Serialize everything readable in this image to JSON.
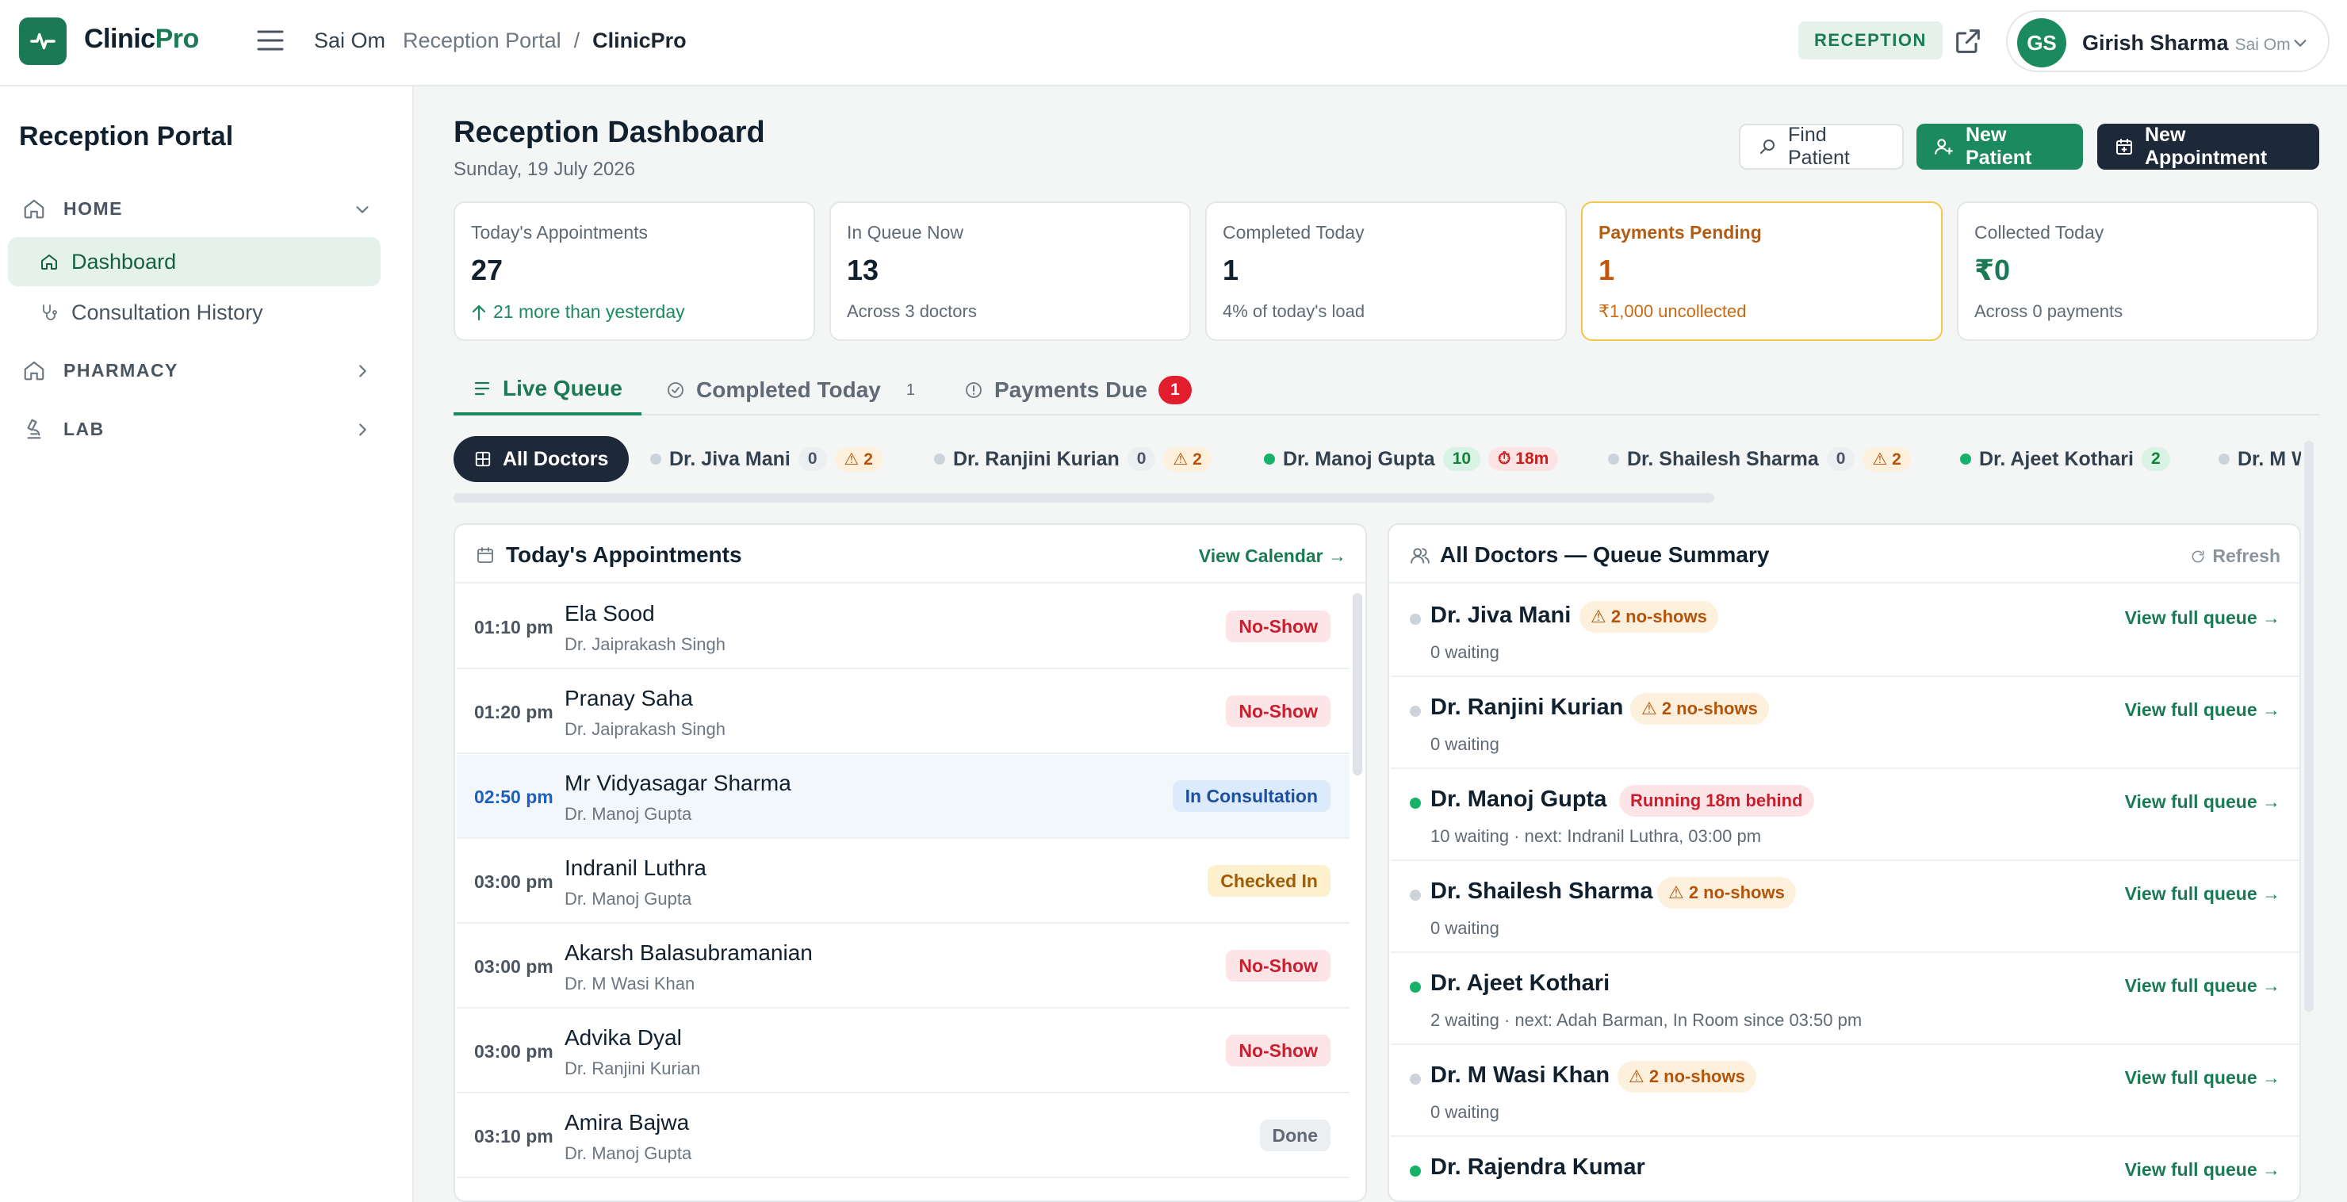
{
  "app": {
    "brand_main": "Clinic",
    "brand_accent": "Pro",
    "clinic": "Sai Om",
    "breadcrumb": [
      "Reception Portal",
      "/",
      "ClinicPro"
    ],
    "role": "RECEPTION"
  },
  "user": {
    "initials": "GS",
    "name": "Girish Sharma",
    "sub": "Sai Om"
  },
  "sidebar": {
    "title": "Reception Portal",
    "home": "HOME",
    "items": [
      "Dashboard",
      "Consultation History"
    ],
    "pharmacy": "PHARMACY",
    "lab": "LAB"
  },
  "page": {
    "title": "Reception Dashboard",
    "date": "Sunday, 19 July 2026"
  },
  "actions": {
    "find": "Find Patient",
    "new_patient": "New Patient",
    "new_appt": "New Appointment"
  },
  "stats": [
    {
      "label": "Today's Appointments",
      "value": "27",
      "sub": "21 more than yesterday"
    },
    {
      "label": "In Queue Now",
      "value": "13",
      "sub": "Across 3 doctors"
    },
    {
      "label": "Completed Today",
      "value": "1",
      "sub": "4% of today's load"
    },
    {
      "label": "Payments Pending",
      "value": "1",
      "sub": "₹1,000 uncollected"
    },
    {
      "label": "Collected Today",
      "value": "₹0",
      "sub": "Across 0 payments"
    }
  ],
  "tabs": [
    {
      "label": "Live Queue"
    },
    {
      "label": "Completed Today",
      "count": "1"
    },
    {
      "label": "Payments Due",
      "count": "1"
    }
  ],
  "doctor_chips": {
    "all": "All Doctors",
    "items": [
      {
        "name": "Dr. Jiva Mani",
        "count": "0",
        "warn": "⚠ 2"
      },
      {
        "name": "Dr. Ranjini Kurian",
        "count": "0",
        "warn": "⚠ 2"
      },
      {
        "name": "Dr. Manoj Gupta",
        "count": "10",
        "late": "⏱ 18m"
      },
      {
        "name": "Dr. Shailesh Sharma",
        "count": "0",
        "warn": "⚠ 2"
      },
      {
        "name": "Dr. Ajeet Kothari",
        "count": "2"
      },
      {
        "name": "Dr. M W"
      }
    ]
  },
  "appointments": {
    "title": "Today's Appointments",
    "link": "View Calendar →",
    "rows": [
      {
        "time": "01:10 pm",
        "patient": "Ela Sood",
        "doctor": "Dr. Jaiprakash Singh",
        "status": "No-Show"
      },
      {
        "time": "01:20 pm",
        "patient": "Pranay Saha",
        "doctor": "Dr. Jaiprakash Singh",
        "status": "No-Show"
      },
      {
        "time": "02:50 pm",
        "patient": "Mr Vidyasagar Sharma",
        "doctor": "Dr. Manoj Gupta",
        "status": "In Consultation"
      },
      {
        "time": "03:00 pm",
        "patient": "Indranil Luthra",
        "doctor": "Dr. Manoj Gupta",
        "status": "Checked In"
      },
      {
        "time": "03:00 pm",
        "patient": "Akarsh Balasubramanian",
        "doctor": "Dr. M Wasi Khan",
        "status": "No-Show"
      },
      {
        "time": "03:00 pm",
        "patient": "Advika Dyal",
        "doctor": "Dr. Ranjini Kurian",
        "status": "No-Show"
      },
      {
        "time": "03:10 pm",
        "patient": "Amira Bajwa",
        "doctor": "Dr. Manoj Gupta",
        "status": "Done"
      }
    ]
  },
  "queue": {
    "title": "All Doctors — Queue Summary",
    "refresh": "Refresh",
    "link": "View full queue →",
    "rows": [
      {
        "name": "Dr. Jiva Mani",
        "tag": "⚠ 2 no-shows",
        "sub": "0 waiting"
      },
      {
        "name": "Dr. Ranjini Kurian",
        "tag": "⚠ 2 no-shows",
        "sub": "0 waiting"
      },
      {
        "name": "Dr. Manoj Gupta",
        "tag": "Running 18m behind",
        "sub": "10 waiting · next: Indranil Luthra, 03:00 pm"
      },
      {
        "name": "Dr. Shailesh Sharma",
        "tag": "⚠ 2 no-shows",
        "sub": "0 waiting"
      },
      {
        "name": "Dr. Ajeet Kothari",
        "tag": "",
        "sub": "2 waiting · next: Adah Barman, In Room since 03:50 pm"
      },
      {
        "name": "Dr. M Wasi Khan",
        "tag": "⚠ 2 no-shows",
        "sub": "0 waiting"
      },
      {
        "name": "Dr. Rajendra Kumar",
        "tag": "",
        "sub": ""
      }
    ]
  },
  "colors": {
    "accent": "#1b8a5e",
    "dark": "#1d2939",
    "warn": "#f3c74a",
    "danger": "#e11d2e"
  }
}
